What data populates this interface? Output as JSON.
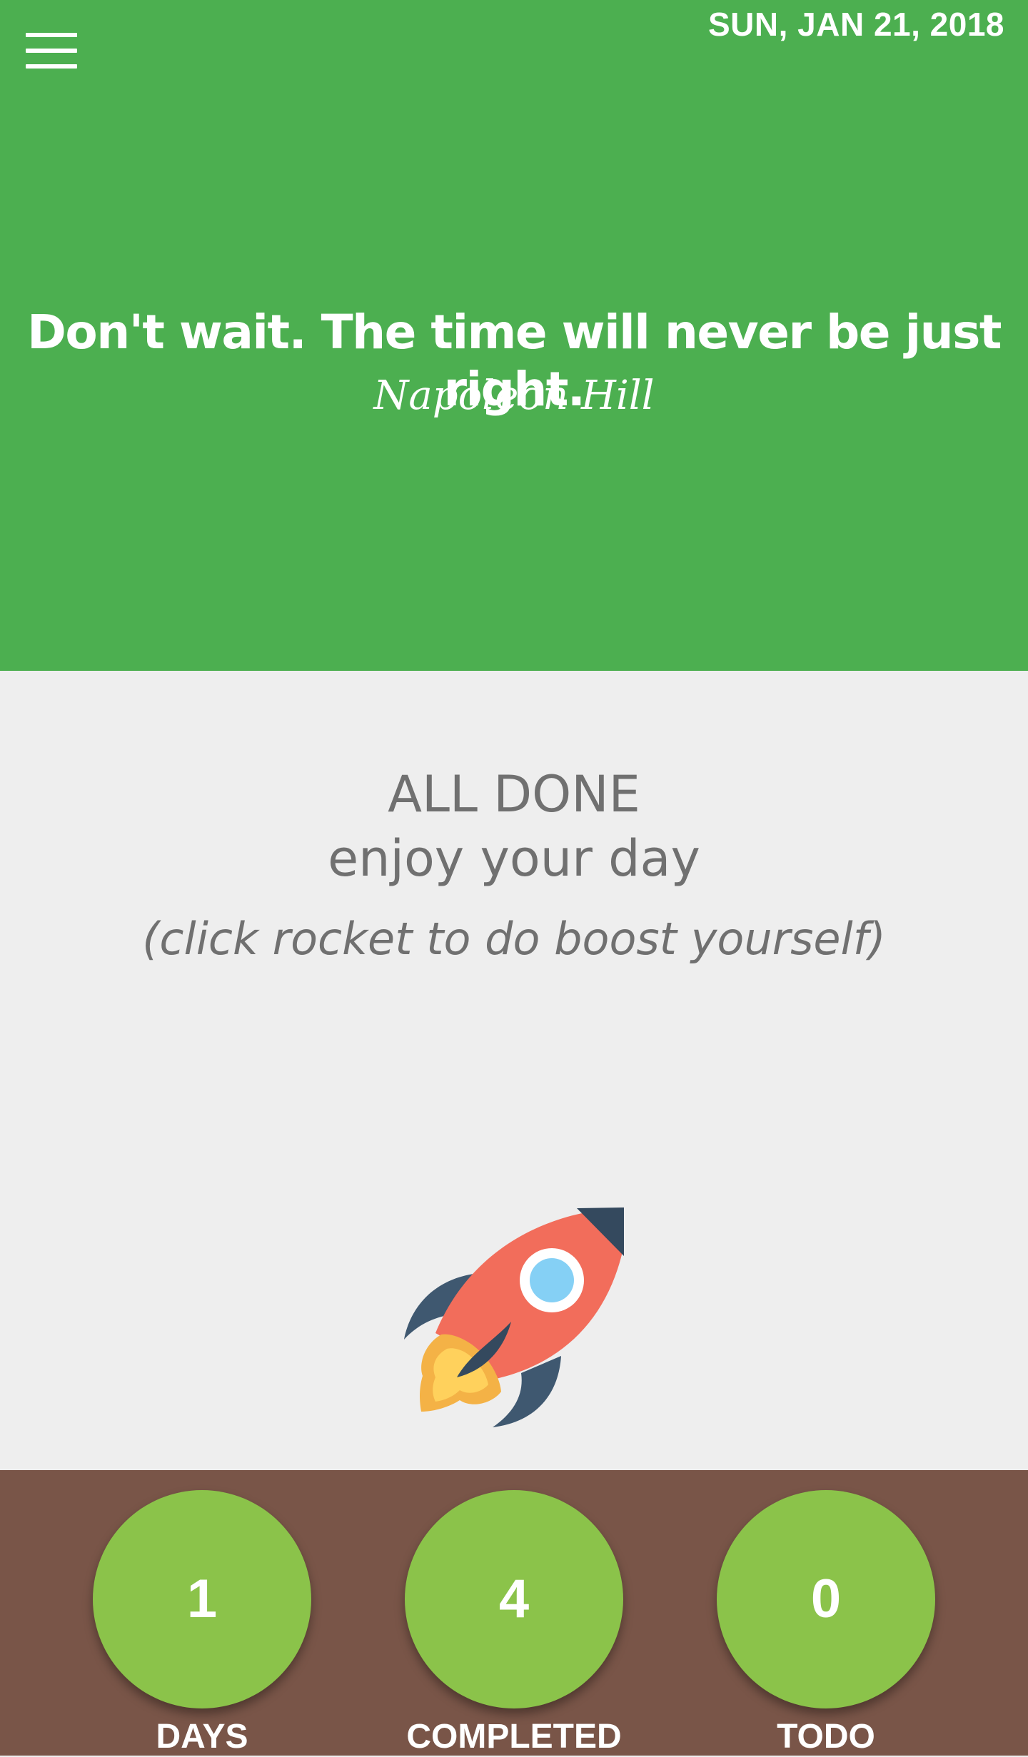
{
  "header": {
    "date": "SUN, JAN 21, 2018",
    "menu_icon": "hamburger-menu-icon",
    "quote": "Don't wait. The time will never be just right.",
    "author": "Napoleon Hill",
    "background_color": "#4caf50"
  },
  "status": {
    "title": "ALL DONE",
    "subtitle": "enjoy your day",
    "hint": "(click rocket to do boost yourself)",
    "rocket_icon": "rocket-icon",
    "background_color": "#eeeeee"
  },
  "stats": [
    {
      "value": "1",
      "label": "DAYS"
    },
    {
      "value": "4",
      "label": "COMPLETED"
    },
    {
      "value": "0",
      "label": "TODO"
    }
  ],
  "footer": {
    "background_color": "#795548",
    "circle_color": "#8bc34a"
  }
}
